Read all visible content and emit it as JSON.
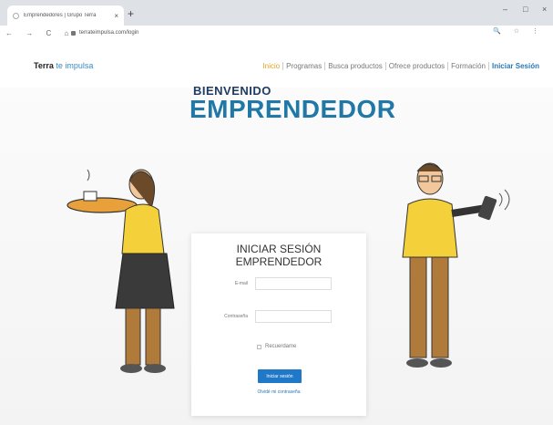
{
  "browser": {
    "tab_title": "Emprendedores | Grupo Terra",
    "tab_close": "×",
    "new_tab": "+",
    "url": "terrateimpulsa.com/login",
    "nav_glyphs": "← → C ⌂",
    "right_glyphs": "🔍 ☆ ⋮",
    "min": "–",
    "max": "□",
    "close": "×"
  },
  "header": {
    "logo_brand": "Terra",
    "logo_tagline": "te impulsa",
    "nav": [
      "Inicio",
      "Programas",
      "Busca productos",
      "Ofrece productos",
      "Formación",
      "Iniciar Sesión"
    ]
  },
  "hero": {
    "welcome_small": "BIENVENIDO",
    "welcome_big": "EMPRENDEDOR"
  },
  "login": {
    "title_line1": "INICIAR SESIÓN",
    "title_line2": "EMPRENDEDOR",
    "email_label": "E-mail",
    "password_label": "Contraseña",
    "remember_label": "Recuerdame",
    "submit_label": "Iniciar sesión",
    "forgot_label": "Olvidé mi contraseña"
  },
  "colors": {
    "accent_blue": "#1f78c8",
    "title_blue": "#1f78a5",
    "menu_active": "#e0a522"
  }
}
